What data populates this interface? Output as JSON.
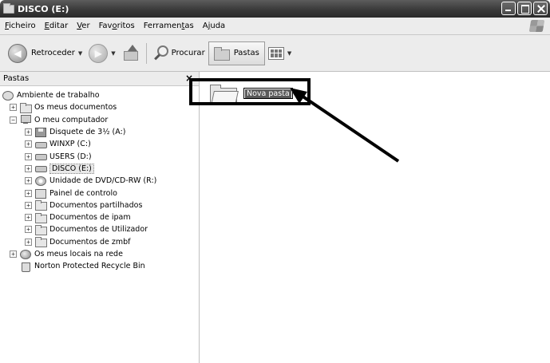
{
  "window": {
    "title": "DISCO (E:)"
  },
  "menu": [
    {
      "pre": "",
      "key": "F",
      "post": "icheiro"
    },
    {
      "pre": "",
      "key": "E",
      "post": "ditar"
    },
    {
      "pre": "",
      "key": "V",
      "post": "er"
    },
    {
      "pre": "Fav",
      "key": "o",
      "post": "ritos"
    },
    {
      "pre": "Ferramen",
      "key": "t",
      "post": "as"
    },
    {
      "pre": "A",
      "key": "j",
      "post": "uda"
    }
  ],
  "toolbar": {
    "back_label": "Retroceder",
    "search_label": "Procurar",
    "folders_label": "Pastas"
  },
  "pane": {
    "title": "Pastas",
    "close_glyph": "×"
  },
  "tree": [
    {
      "label": "Ambiente de trabalho",
      "icon": "desktop-icon"
    },
    {
      "label": "Os meus documentos",
      "icon": "documents-folder-icon"
    },
    {
      "label": "O meu computador",
      "icon": "computer-icon"
    },
    {
      "label": "Disquete de 3½ (A:)",
      "icon": "floppy-drive-icon"
    },
    {
      "label": "WINXP (C:)",
      "icon": "hard-drive-icon"
    },
    {
      "label": "USERS (D:)",
      "icon": "hard-drive-icon"
    },
    {
      "label": "DISCO (E:)",
      "icon": "hard-drive-icon"
    },
    {
      "label": "Unidade de DVD/CD-RW (R:)",
      "icon": "cd-drive-icon"
    },
    {
      "label": "Painel de controlo",
      "icon": "control-panel-icon"
    },
    {
      "label": "Documentos partilhados",
      "icon": "folder-icon"
    },
    {
      "label": "Documentos de ipam",
      "icon": "folder-icon"
    },
    {
      "label": "Documentos de Utilizador",
      "icon": "folder-icon"
    },
    {
      "label": "Documentos de zmbf",
      "icon": "folder-icon"
    },
    {
      "label": "Os meus locais na rede",
      "icon": "network-icon"
    },
    {
      "label": "Norton Protected Recycle Bin",
      "icon": "recycle-bin-icon"
    }
  ],
  "content": {
    "new_folder_name": "Nova pasta"
  }
}
